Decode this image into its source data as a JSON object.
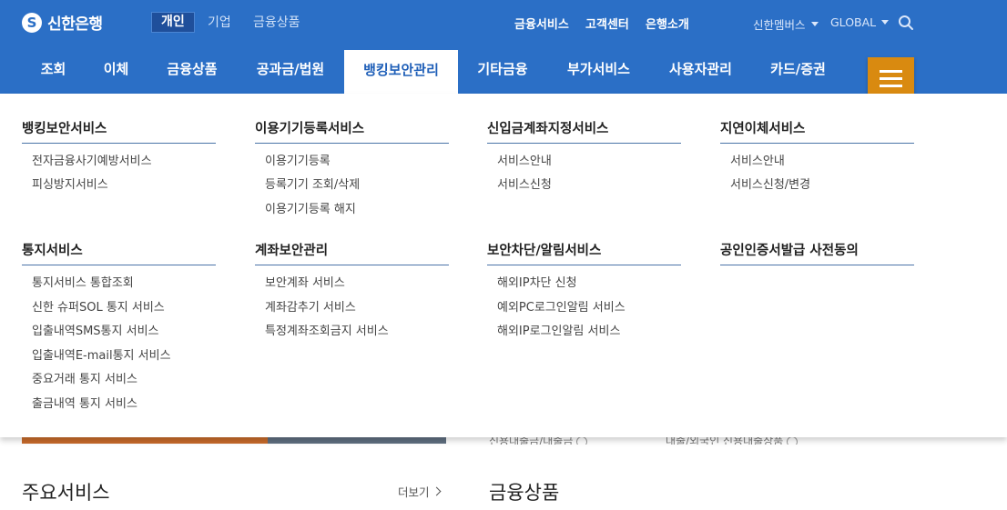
{
  "brand": {
    "name": "신한은행"
  },
  "segments": [
    "개인",
    "기업",
    "금융상품"
  ],
  "top_links": [
    "금융서비스",
    "고객센터",
    "은행소개"
  ],
  "utility": {
    "members": "신한멤버스",
    "global": "GLOBAL"
  },
  "main_nav": [
    "조회",
    "이체",
    "금융상품",
    "공과금/법원",
    "뱅킹보안관리",
    "기타금융",
    "부가서비스",
    "사용자관리",
    "카드/증권"
  ],
  "mega_menu": {
    "groups": [
      {
        "title": "뱅킹보안서비스",
        "items": [
          "전자금융사기예방서비스",
          "피싱방지서비스"
        ]
      },
      {
        "title": "이용기기등록서비스",
        "items": [
          "이용기기등록",
          "등록기기 조회/삭제",
          "이용기기등록 해지"
        ]
      },
      {
        "title": "신입금계좌지정서비스",
        "items": [
          "서비스안내",
          "서비스신청"
        ]
      },
      {
        "title": "지연이체서비스",
        "items": [
          "서비스안내",
          "서비스신청/변경"
        ]
      },
      {
        "title": "통지서비스",
        "items": [
          "통지서비스 통합조회",
          "신한 슈퍼SOL 통지 서비스",
          "입출내역SMS통지 서비스",
          "입출내역E-mail통지 서비스",
          "중요거래 통지 서비스",
          "출금내역 통지 서비스"
        ]
      },
      {
        "title": "계좌보안관리",
        "items": [
          "보안계좌 서비스",
          "계좌감추기 서비스",
          "특정계좌조회금지 서비스"
        ]
      },
      {
        "title": "보안차단/알림서비스",
        "items": [
          "해외IP차단 신청",
          "예외PC로그인알림 서비스",
          "해외IP로그인알림 서비스"
        ]
      },
      {
        "title": "공인인증서발급 사전동의",
        "items": []
      }
    ]
  },
  "background": {
    "partial_text_1": "신용대출금/대출금",
    "partial_text_2": "대출/외국인 신용대출상품",
    "main_services_title": "주요서비스",
    "more_label": "더보기",
    "products_title": "금융상품"
  },
  "colors": {
    "primary": "#2b6fc6",
    "menu_button": "#d98a10",
    "active_tab_text": "#1f5fb8"
  }
}
